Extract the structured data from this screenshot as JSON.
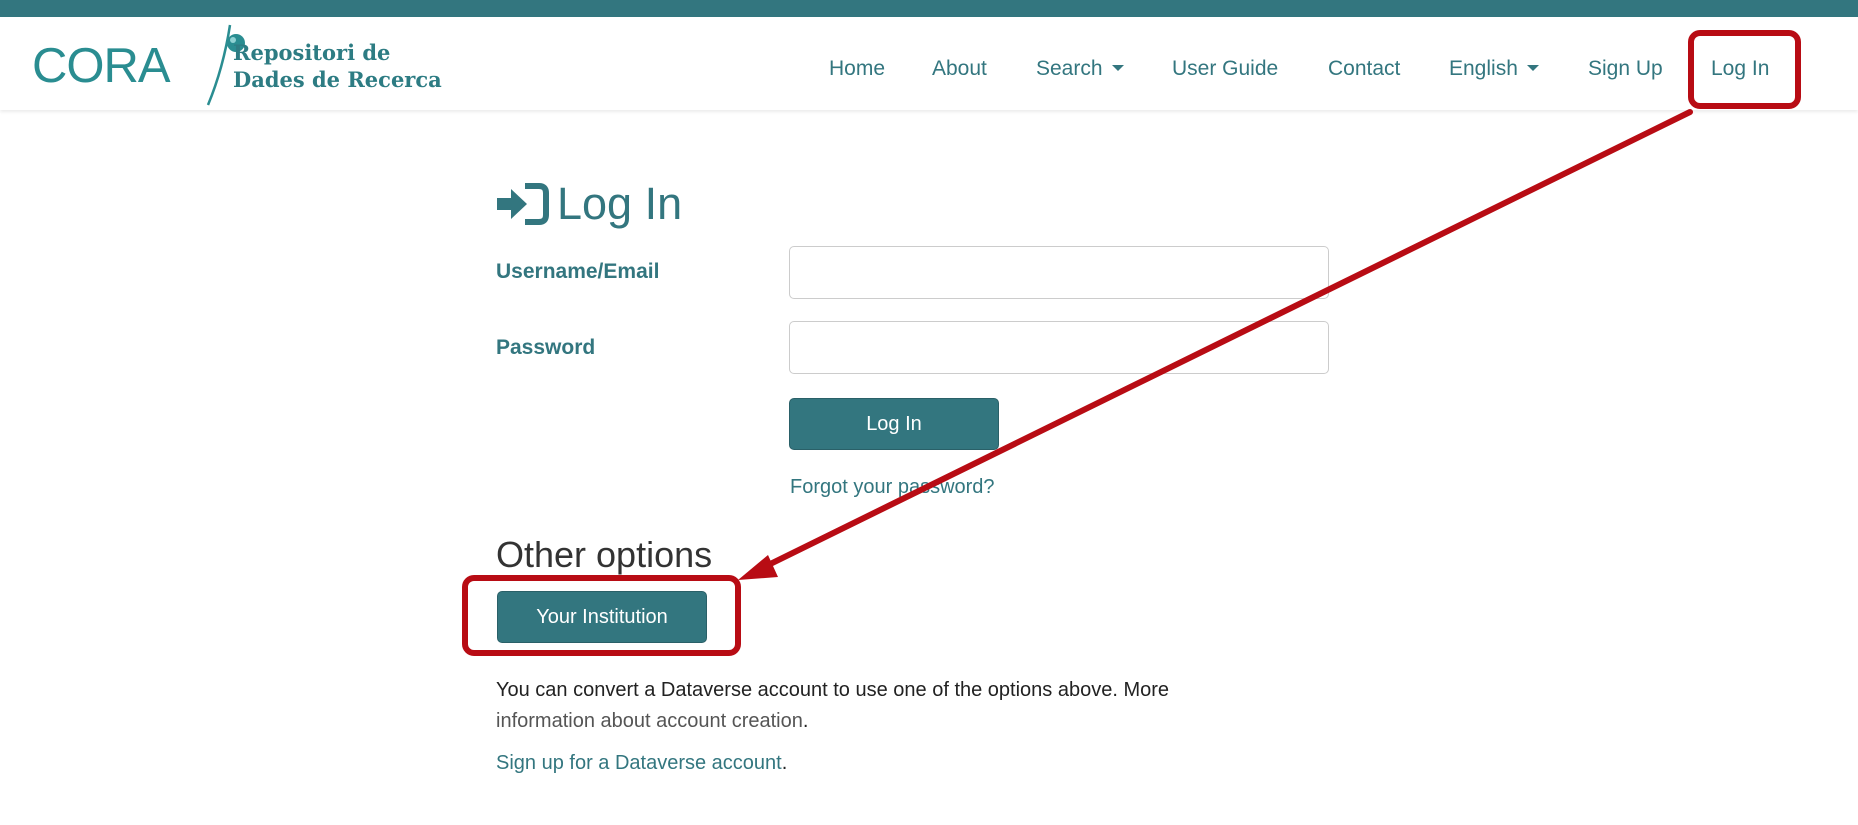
{
  "brand": {
    "logo_word": "CORA",
    "subtitle_line1": "Repositori de",
    "subtitle_line2": "Dades de Recerca"
  },
  "nav": {
    "home": "Home",
    "about": "About",
    "search": "Search",
    "user_guide": "User Guide",
    "contact": "Contact",
    "language": "English",
    "sign_up": "Sign Up",
    "log_in": "Log In"
  },
  "login": {
    "title": "Log In",
    "username_label": "Username/Email",
    "username_value": "",
    "password_label": "Password",
    "password_value": "",
    "submit_label": "Log In",
    "forgot_link": "Forgot your password?"
  },
  "other_options": {
    "heading": "Other options",
    "institution_button": "Your Institution",
    "info_text_1": "You can convert a Dataverse account to use one of the options above. More",
    "info_link": "information about account creation",
    "info_end": ".",
    "signup_link": "Sign up for a Dataverse account",
    "signup_end": "."
  },
  "colors": {
    "brand_teal": "#33767f",
    "annotation_red": "#b80c14",
    "top_strip": "#33767f"
  },
  "icons": {
    "login_heading_icon": "sign-in-icon",
    "search_caret": "caret-down-icon",
    "language_caret": "caret-down-icon"
  }
}
